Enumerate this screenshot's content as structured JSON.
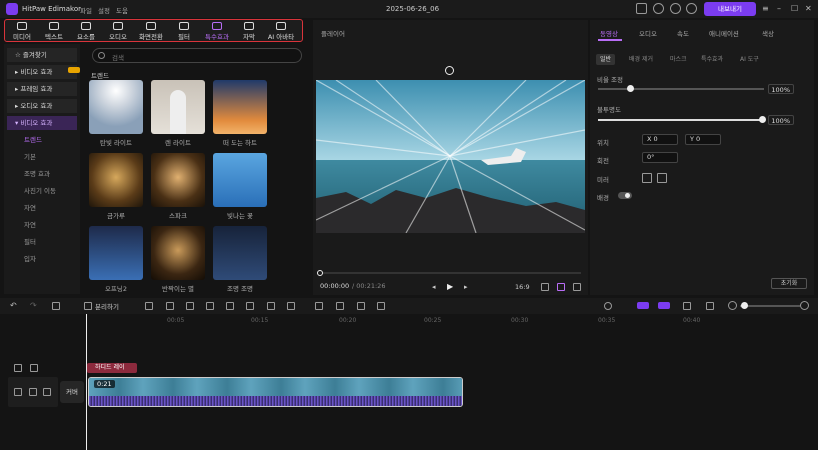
{
  "app": {
    "name": "HitPaw Edimakor",
    "menus": [
      "파일",
      "설정",
      "도움"
    ],
    "doc_title": "2025-06-26_06",
    "export_label": "내보내기",
    "accent": "#7b3cf0"
  },
  "toolbar": {
    "items": [
      {
        "label": "미디어",
        "icon": "media-icon"
      },
      {
        "label": "텍스트",
        "icon": "text-icon"
      },
      {
        "label": "요소를",
        "icon": "elements-icon"
      },
      {
        "label": "오디오",
        "icon": "audio-icon"
      },
      {
        "label": "화면전환",
        "icon": "transition-icon"
      },
      {
        "label": "필터",
        "icon": "filter-icon"
      },
      {
        "label": "특수효과",
        "icon": "effects-icon"
      },
      {
        "label": "자막",
        "icon": "subtitle-icon"
      },
      {
        "label": "AI 아바타",
        "icon": "avatar-icon"
      }
    ],
    "active": "특수효과"
  },
  "sidebar": {
    "favorites": "즐겨찾기",
    "groups": [
      "비디오 효과",
      "프레임 효과",
      "오디오 효과"
    ],
    "open_group": "비디오 효과",
    "subs": [
      "트렌드",
      "기본",
      "조명 효과",
      "사진기 이동",
      "자연",
      "자연",
      "필터",
      "입자"
    ],
    "active_sub": "트렌드"
  },
  "content": {
    "search_placeholder": "검색",
    "section": "트렌드",
    "items": [
      {
        "label": "탄빛 라이트"
      },
      {
        "label": "렌 라이트"
      },
      {
        "label": "떠 도는 하트"
      },
      {
        "label": "금가루"
      },
      {
        "label": "스파크"
      },
      {
        "label": "빛나는 꽃"
      },
      {
        "label": "오프닝2"
      },
      {
        "label": "반짝이는 별"
      },
      {
        "label": "조명 조명"
      }
    ]
  },
  "player": {
    "title": "플레이어",
    "current_time": "00:00:00",
    "total_time": "/ 00:21:26",
    "ratio": "16:9"
  },
  "props": {
    "tabs": [
      "동영상",
      "오디오",
      "속도",
      "애니메이션",
      "색상"
    ],
    "active_tab": "동영상",
    "subtabs": [
      "일반",
      "배경 제거",
      "마스크",
      "특수효과",
      "AI 도구"
    ],
    "active_subtab": "일반",
    "scale_label": "비율 조정",
    "scale_value": "100%",
    "opacity_label": "불투명도",
    "opacity_value": "100%",
    "position_label": "위치",
    "pos_x": "X  0",
    "pos_y": "Y  0",
    "rotate_label": "회전",
    "rotate_value": "0°",
    "mirror_label": "미러",
    "bg_label": "배경",
    "reset_label": "초기화"
  },
  "timeline": {
    "split_label": "분리하기",
    "ticks": [
      "00:05",
      "00:15",
      "00:20",
      "00:25",
      "00:30",
      "00:35",
      "00:40"
    ],
    "track_label": "하디드 레이",
    "clip_duration": "0:21",
    "cover_label": "커버"
  }
}
